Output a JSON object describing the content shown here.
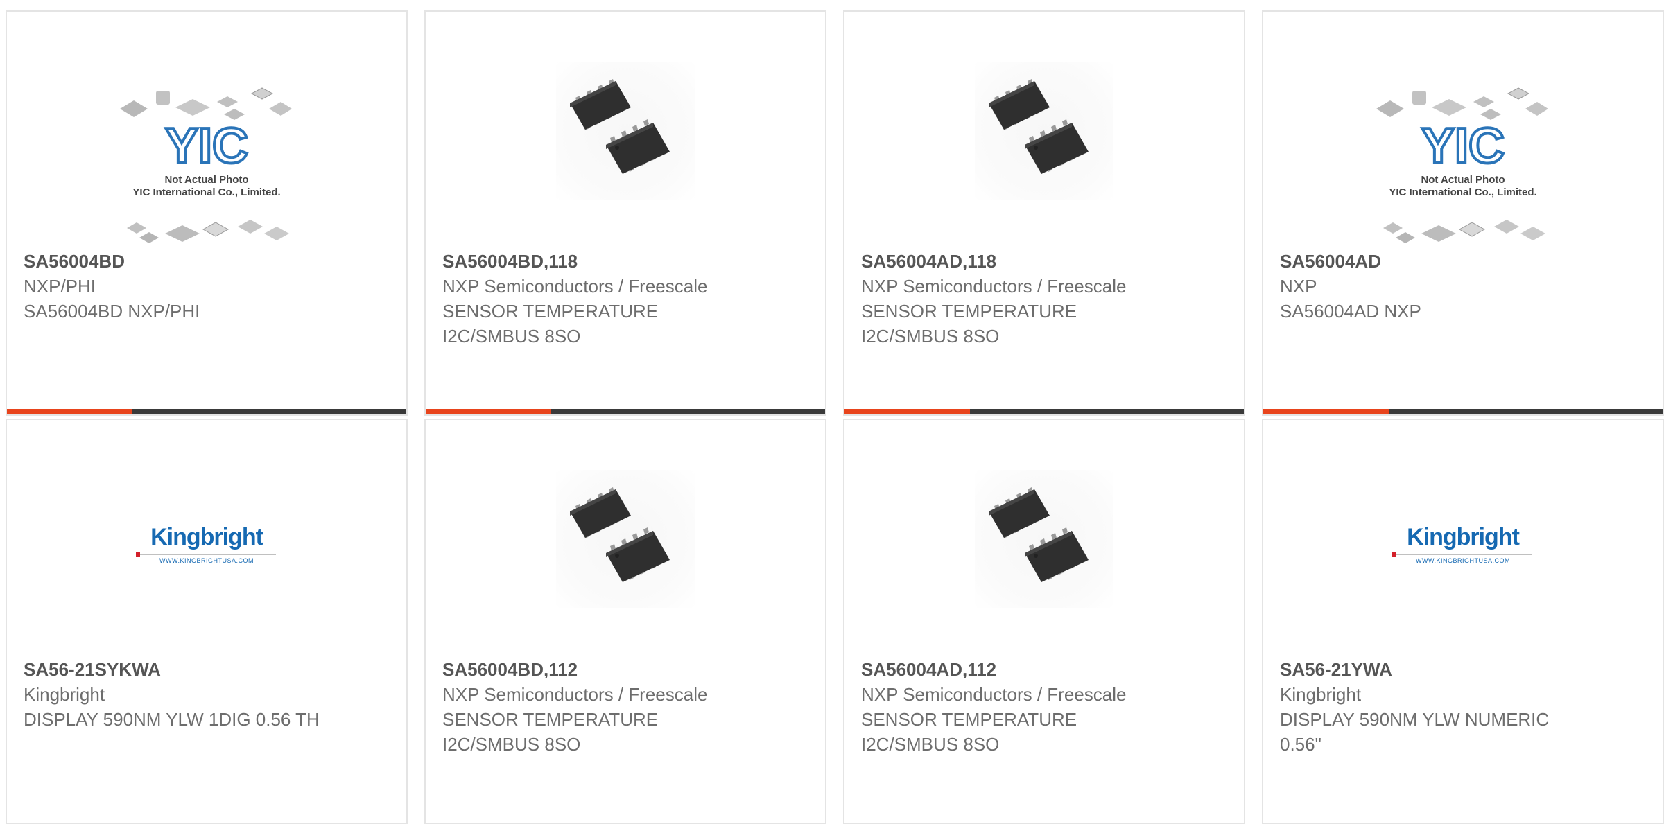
{
  "theme": {
    "accent": "#e8441c",
    "bar_base": "#3a3a3a",
    "card_border": "#e4e4e4"
  },
  "placeholder": {
    "caption_line1": "Not Actual Photo",
    "caption_line2": "YIC International Co., Limited.",
    "logo_text": "YIC"
  },
  "kingbright": {
    "name": "Kingbright",
    "url": "WWW.KINGBRIGHTUSA.COM"
  },
  "cards": [
    {
      "part": "SA56004BD",
      "maker": "NXP/PHI",
      "desc": "SA56004BD NXP/PHI",
      "image": "yic-placeholder",
      "progress": 0.315
    },
    {
      "part": "SA56004BD,118",
      "maker": "NXP Semiconductors / Freescale",
      "desc": "SENSOR TEMPERATURE I2C/SMBUS 8SO",
      "image": "soic-8-chips",
      "progress": 0.315
    },
    {
      "part": "SA56004AD,118",
      "maker": "NXP Semiconductors / Freescale",
      "desc": "SENSOR TEMPERATURE I2C/SMBUS 8SO",
      "image": "soic-8-chips",
      "progress": 0.315
    },
    {
      "part": "SA56004AD",
      "maker": "NXP",
      "desc": "SA56004AD NXP",
      "image": "yic-placeholder",
      "progress": 0.315
    },
    {
      "part": "SA56-21SYKWA",
      "maker": "Kingbright",
      "desc": "DISPLAY 590NM YLW 1DIG 0.56 TH",
      "image": "kingbright-logo"
    },
    {
      "part": "SA56004BD,112",
      "maker": "NXP Semiconductors / Freescale",
      "desc": "SENSOR TEMPERATURE I2C/SMBUS 8SO",
      "image": "soic-8-chips"
    },
    {
      "part": "SA56004AD,112",
      "maker": "NXP Semiconductors / Freescale",
      "desc": "SENSOR TEMPERATURE I2C/SMBUS 8SO",
      "image": "soic-8-chips"
    },
    {
      "part": "SA56-21YWA",
      "maker": "Kingbright",
      "desc": "DISPLAY 590NM YLW NUMERIC 0.56\"",
      "image": "kingbright-logo"
    }
  ]
}
